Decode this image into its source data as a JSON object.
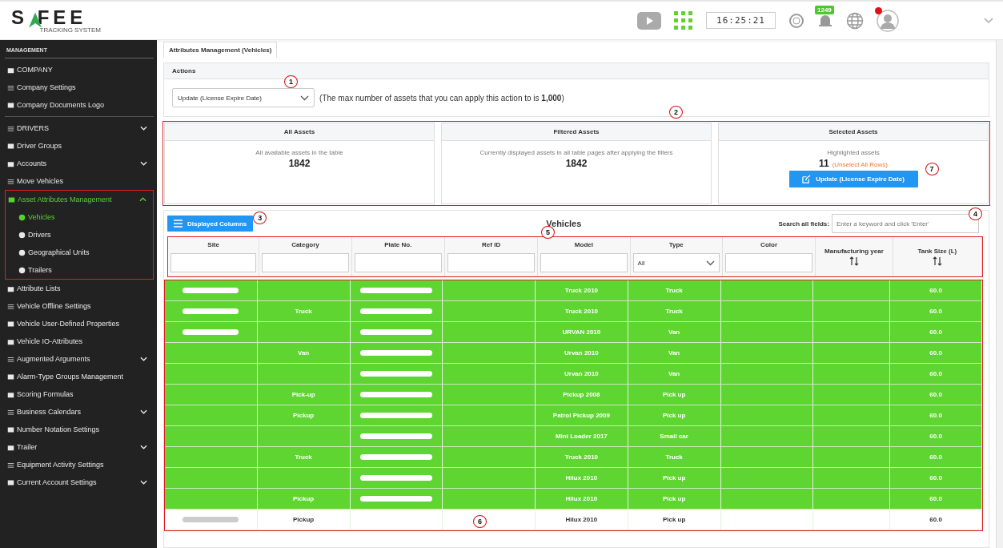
{
  "header": {
    "logo_text": "S FEE",
    "logo_tagline": "TRACKING SYSTEM",
    "clock": "16:25:21",
    "notification_count": "1249",
    "avatar_alert": true
  },
  "sidebar": {
    "heading": "MANAGEMENT",
    "sections": [
      {
        "items": [
          {
            "label": "COMPANY",
            "kind": "link",
            "selected": false
          },
          {
            "label": "Company Settings",
            "kind": "link",
            "selected": false
          },
          {
            "label": "Company Documents Logo",
            "kind": "link",
            "selected": false
          }
        ]
      },
      {
        "items": [
          {
            "label": "DRIVERS",
            "kind": "group",
            "expanded": false,
            "selected": false
          },
          {
            "label": "Driver Groups",
            "kind": "link",
            "selected": false
          },
          {
            "label": "Accounts",
            "kind": "group",
            "expanded": false,
            "selected": false
          },
          {
            "label": "Move Vehicles",
            "kind": "link",
            "selected": false
          },
          {
            "label": "Asset Attributes Management",
            "kind": "group",
            "expanded": true,
            "selected": true,
            "outlined": true,
            "children": [
              {
                "label": "Vehicles",
                "selected": true
              },
              {
                "label": "Drivers",
                "selected": false
              },
              {
                "label": "Geographical Units",
                "selected": false
              },
              {
                "label": "Trailers",
                "selected": false
              }
            ]
          },
          {
            "label": "Attribute Lists",
            "kind": "link",
            "selected": false
          },
          {
            "label": "Vehicle Offline Settings",
            "kind": "link",
            "selected": false
          },
          {
            "label": "Vehicle User-Defined Properties",
            "kind": "link",
            "selected": false
          },
          {
            "label": "Vehicle IO-Attributes",
            "kind": "link",
            "selected": false
          },
          {
            "label": "Augmented Arguments",
            "kind": "group",
            "expanded": false,
            "selected": false
          },
          {
            "label": "Alarm-Type Groups Management",
            "kind": "link",
            "selected": false
          },
          {
            "label": "Scoring Formulas",
            "kind": "link",
            "selected": false
          },
          {
            "label": "Business Calendars",
            "kind": "group",
            "expanded": false,
            "selected": false
          },
          {
            "label": "Number Notation Settings",
            "kind": "link",
            "selected": false
          },
          {
            "label": "Trailer",
            "kind": "group",
            "expanded": false,
            "selected": false
          },
          {
            "label": "Equipment Activity Settings",
            "kind": "link",
            "selected": false
          },
          {
            "label": "Current Account Settings",
            "kind": "group",
            "expanded": false,
            "selected": false
          }
        ]
      }
    ]
  },
  "page_tab": "Attributes Management (Vehicles)",
  "actions": {
    "title": "Actions",
    "select_value": "Update (License Expire Date)",
    "callout": "1",
    "note": "(The max number of assets that you can apply this action to is **1,000**)"
  },
  "summary": {
    "callout": "2",
    "outlined": true,
    "cards": [
      {
        "title": "All Assets",
        "description": "All available assets in the table",
        "count": "1842"
      },
      {
        "title": "Filtered Assets",
        "description": "Currently displayed assets in all table pages after applying the filters",
        "count": "1842"
      },
      {
        "title": "Selected Assets",
        "description": "Highlighted assets",
        "count": "11",
        "link": "(Unselect All Rows)",
        "button": "Update (License Expire Date)",
        "callout": "7"
      }
    ]
  },
  "table": {
    "title": "Vehicles",
    "columns_button": "Displayed Columns",
    "columns_callout": "3",
    "search_label": "Search all fields:",
    "search_placeholder": "Enter a keyword and click 'Enter'",
    "search_callout": "4",
    "header_callout": "5",
    "header_outlined": true,
    "body_callout": "6",
    "body_outlined": true,
    "columns": [
      {
        "label": "Site",
        "kind": "text"
      },
      {
        "label": "Category",
        "kind": "text"
      },
      {
        "label": "Plate No.",
        "kind": "text"
      },
      {
        "label": "Ref ID",
        "kind": "text"
      },
      {
        "label": "Model",
        "kind": "text"
      },
      {
        "label": "Type",
        "kind": "select",
        "value": "All"
      },
      {
        "label": "Color",
        "kind": "text"
      },
      {
        "label": "Manufacturing year",
        "kind": "sort"
      },
      {
        "label": "Tank Size (L)",
        "kind": "sort"
      }
    ],
    "rows": [
      {
        "selected": true,
        "site_redacted": true,
        "plate_redacted": true,
        "model": "Truck 2010",
        "type": "Truck",
        "tank": "60.0"
      },
      {
        "selected": true,
        "site_redacted": true,
        "category": "Truck",
        "plate_redacted": true,
        "model": "Truck 2010",
        "type": "Truck",
        "tank": "60.0"
      },
      {
        "selected": true,
        "site_redacted": true,
        "plate_redacted": true,
        "model": "URVAN 2010",
        "type": "Van",
        "tank": "60.0"
      },
      {
        "selected": true,
        "site_redacted": false,
        "category": "Van",
        "plate_redacted": true,
        "model": "Urvan 2010",
        "type": "Van",
        "tank": "60.0"
      },
      {
        "selected": true,
        "site_redacted": false,
        "plate_redacted": true,
        "model": "Urvan 2010",
        "type": "Van",
        "tank": "60.0"
      },
      {
        "selected": true,
        "site_redacted": false,
        "category": "Pick-up",
        "plate_redacted": true,
        "model": "Pickup 2008",
        "type": "Pick up",
        "tank": "60.0"
      },
      {
        "selected": true,
        "site_redacted": false,
        "category": "Pickup",
        "plate_redacted": true,
        "model": "Patrol Pickup 2009",
        "type": "Pick up",
        "tank": "60.0"
      },
      {
        "selected": true,
        "site_redacted": false,
        "plate_redacted": true,
        "model": "Mini Loader 2017",
        "type": "Small car",
        "tank": "60.0"
      },
      {
        "selected": true,
        "site_redacted": false,
        "category": "Truck",
        "plate_redacted": true,
        "model": "Truck 2010",
        "type": "Truck",
        "tank": "60.0"
      },
      {
        "selected": true,
        "site_redacted": false,
        "plate_redacted": true,
        "model": "Hilux 2010",
        "type": "Pick up",
        "tank": "60.0"
      },
      {
        "selected": true,
        "site_redacted": false,
        "category": "Pickup",
        "plate_redacted": true,
        "model": "Hilux 2010",
        "type": "Pick up",
        "tank": "60.0"
      },
      {
        "selected": false,
        "site_redacted": true,
        "category": "Pickup",
        "plate_redacted": false,
        "model": "Hilux 2010",
        "type": "Pick up",
        "tank": "60.0"
      }
    ]
  }
}
